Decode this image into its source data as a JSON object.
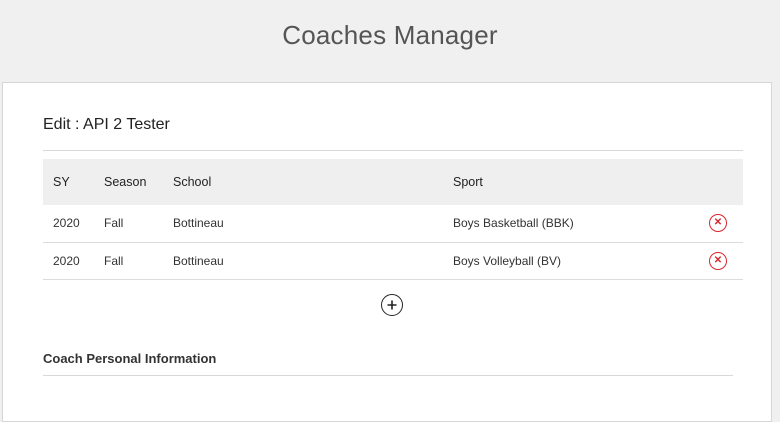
{
  "header": {
    "title": "Coaches Manager"
  },
  "edit": {
    "title": "Edit : API 2 Tester"
  },
  "table": {
    "columns": {
      "sy": "SY",
      "season": "Season",
      "school": "School",
      "sport": "Sport"
    },
    "rows": [
      {
        "sy": "2020",
        "season": "Fall",
        "school": "Bottineau",
        "sport": "Boys Basketball (BBK)"
      },
      {
        "sy": "2020",
        "season": "Fall",
        "school": "Bottineau",
        "sport": "Boys Volleyball (BV)"
      }
    ]
  },
  "icons": {
    "delete": "close-circle-icon",
    "add": "plus-circle-icon"
  },
  "colors": {
    "delete": "#d9262c",
    "header_bg": "#efefef",
    "page_bg": "#f0f0f0"
  },
  "personal_info": {
    "title": "Coach Personal Information"
  }
}
